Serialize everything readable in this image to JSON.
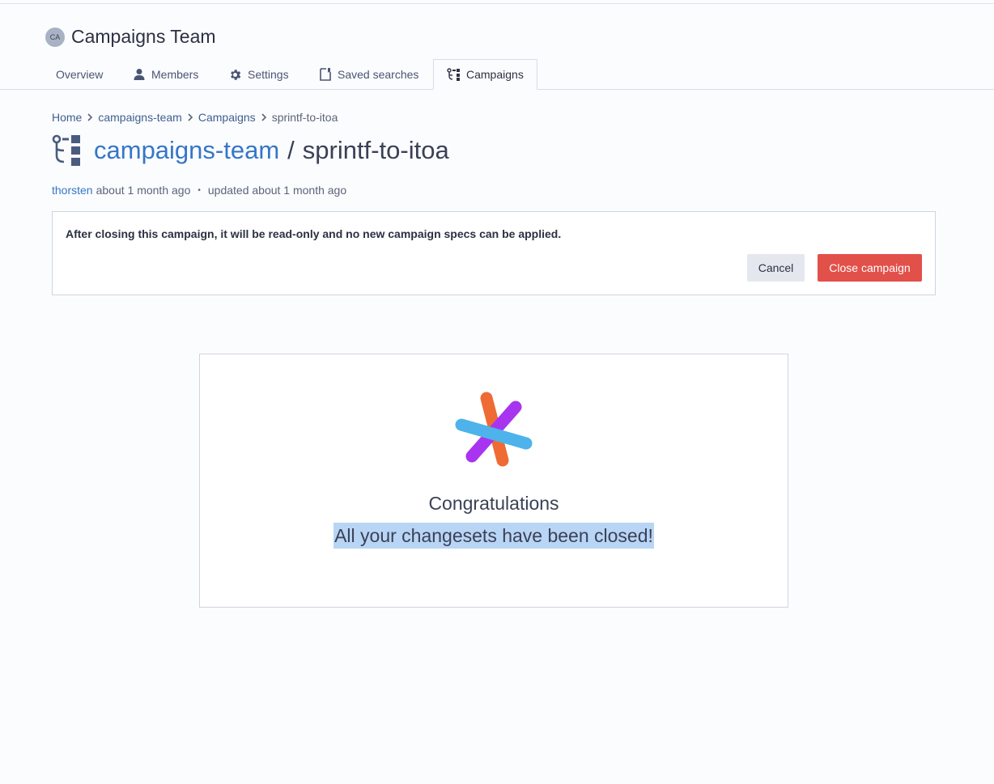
{
  "org": {
    "avatar_initials": "CA",
    "name": "Campaigns Team"
  },
  "tabs": [
    {
      "label": "Overview",
      "icon": "none",
      "active": false
    },
    {
      "label": "Members",
      "icon": "user-icon",
      "active": false
    },
    {
      "label": "Settings",
      "icon": "gear-icon",
      "active": false
    },
    {
      "label": "Saved searches",
      "icon": "saved-search-icon",
      "active": false
    },
    {
      "label": "Campaigns",
      "icon": "campaigns-icon",
      "active": true
    }
  ],
  "breadcrumb": {
    "home": "Home",
    "org": "campaigns-team",
    "section": "Campaigns",
    "current": "sprintf-to-itoa"
  },
  "title": {
    "org": "campaigns-team",
    "separator": "/",
    "name": "sprintf-to-itoa"
  },
  "meta": {
    "author": "thorsten",
    "created": "about 1 month ago",
    "dot": "•",
    "updated": "updated about 1 month ago"
  },
  "notice": {
    "text": "After closing this campaign, it will be read-only and no new campaign specs can be applied.",
    "cancel_label": "Cancel",
    "close_label": "Close campaign"
  },
  "congrats": {
    "title": "Congratulations",
    "message": "All your changesets have been closed!"
  },
  "colors": {
    "link": "#3576c8",
    "danger": "#e2504a",
    "logo_orange": "#ee6b34",
    "logo_purple": "#a934ef",
    "logo_blue": "#4db3ea",
    "selection": "#b9d5f5"
  }
}
